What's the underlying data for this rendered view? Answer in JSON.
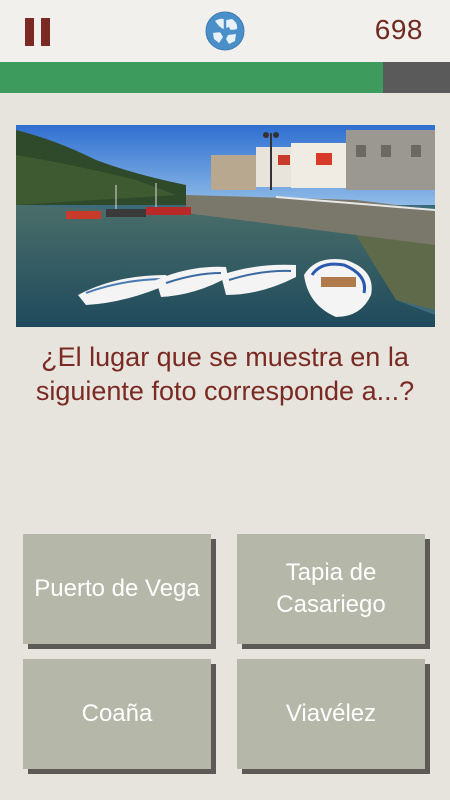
{
  "header": {
    "score": "698",
    "logo_icon": "globe-logo-icon",
    "pause_icon": "pause-icon"
  },
  "progress": {
    "fraction": 0.85,
    "fill_color": "#3d9b5e",
    "track_color": "#5a5a5a"
  },
  "question": {
    "text": "¿El lugar que se muestra en la siguiente foto corresponde a...?"
  },
  "answers": [
    {
      "label": "Puerto de Vega"
    },
    {
      "label": "Tapia de Casariego"
    },
    {
      "label": "Coaña"
    },
    {
      "label": "Viavélez"
    }
  ],
  "colors": {
    "accent": "#7a2a22",
    "answer_bg": "#b5b7a8",
    "answer_shadow": "#5b5a56"
  }
}
